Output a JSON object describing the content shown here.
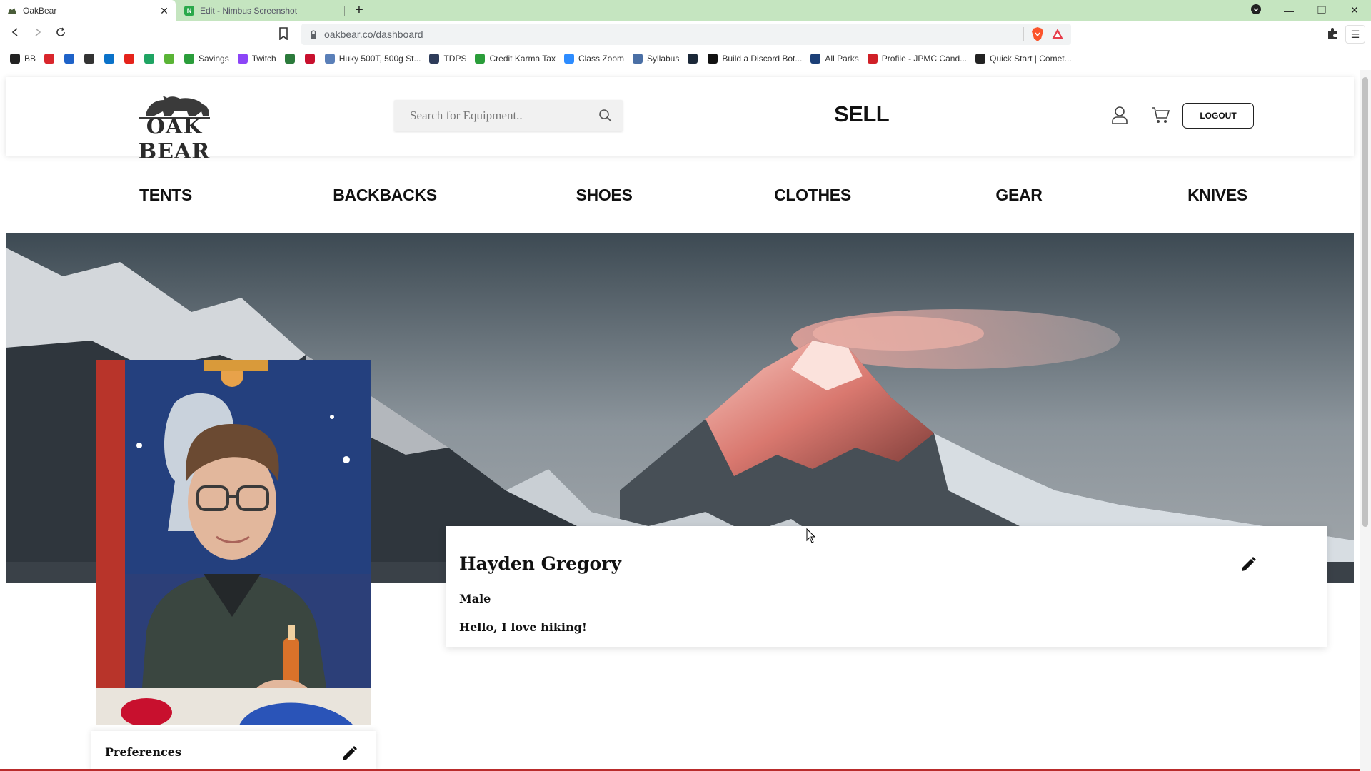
{
  "browser": {
    "tabs": [
      {
        "title": "OakBear",
        "active": true
      },
      {
        "title": "Edit - Nimbus Screenshot",
        "active": false
      }
    ],
    "url": "oakbear.co/dashboard",
    "bookmarks": [
      {
        "label": "BB",
        "color": "#222222"
      },
      {
        "label": "",
        "color": "#d9262c"
      },
      {
        "label": "",
        "color": "#1e62c8"
      },
      {
        "label": "",
        "color": "#333333"
      },
      {
        "label": "",
        "color": "#0a72c9"
      },
      {
        "label": "",
        "color": "#e5231b"
      },
      {
        "label": "",
        "color": "#1fa463"
      },
      {
        "label": "",
        "color": "#5ab436"
      },
      {
        "label": "Savings",
        "color": "#2a9d3a"
      },
      {
        "label": "Twitch",
        "color": "#8c45f7"
      },
      {
        "label": "",
        "color": "#2b7a3b"
      },
      {
        "label": "",
        "color": "#c8102e"
      },
      {
        "label": "Huky 500T, 500g St...",
        "color": "#5a7fb8"
      },
      {
        "label": "TDPS",
        "color": "#2e3c5a"
      },
      {
        "label": "Credit Karma Tax",
        "color": "#2a9d3a"
      },
      {
        "label": "Class Zoom",
        "color": "#2d8cff"
      },
      {
        "label": "Syllabus",
        "color": "#4a6fa5"
      },
      {
        "label": "",
        "color": "#1b2838"
      },
      {
        "label": "Build a Discord Bot...",
        "color": "#111111"
      },
      {
        "label": "All Parks",
        "color": "#1c3f77"
      },
      {
        "label": "Profile - JPMC Cand...",
        "color": "#d02027"
      },
      {
        "label": "Quick Start | Comet...",
        "color": "#222222"
      }
    ]
  },
  "header": {
    "logo_text": "OAK BEAR",
    "search_placeholder": "Search for Equipment..",
    "sell_label": "SELL",
    "logout_label": "LOGOUT"
  },
  "categories": [
    "TENTS",
    "BACKBACKS",
    "SHOES",
    "CLOTHES",
    "GEAR",
    "KNIVES"
  ],
  "profile": {
    "name": "Hayden Gregory",
    "gender": "Male",
    "bio": "Hello, I love hiking!"
  },
  "preferences": {
    "title": "Preferences"
  },
  "colors": {
    "tabbar": "#c5e5c0",
    "page_bottom_accent": "#b92c2c"
  }
}
